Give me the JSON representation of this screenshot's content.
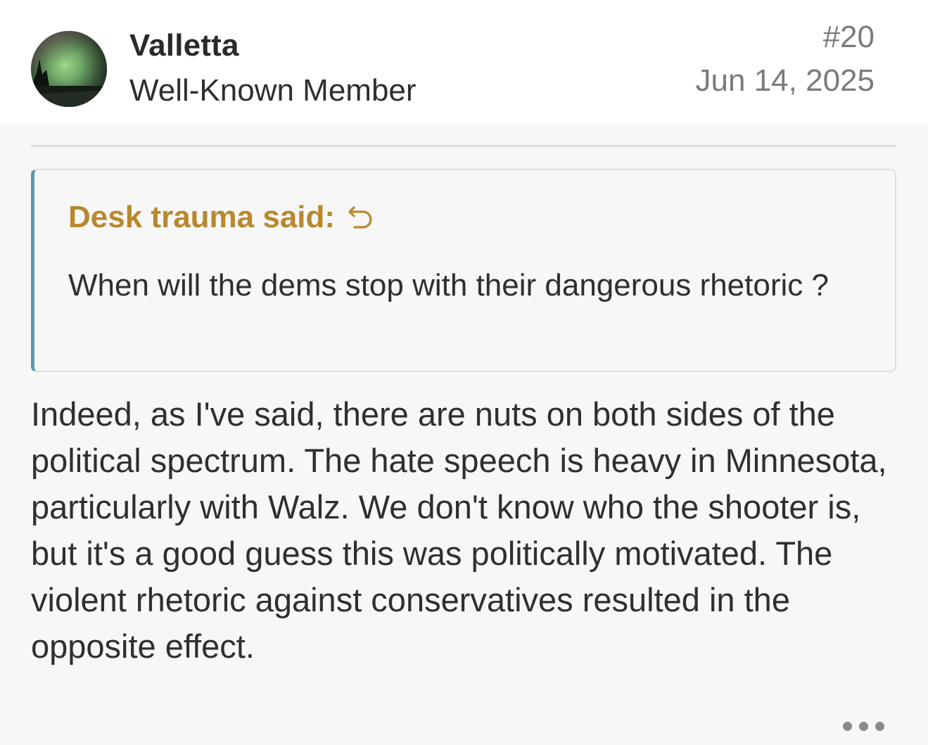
{
  "post": {
    "author": {
      "name": "Valletta",
      "title": "Well-Known Member",
      "avatar_icon": "aurora-landscape-avatar"
    },
    "number": "#20",
    "date": "Jun 14, 2025",
    "quote": {
      "author_label": "Desk trauma said:",
      "jump_icon": "reply-arrow-icon",
      "text": "When will the dems stop with their dangerous rhetoric ?"
    },
    "body": "Indeed, as I've said, there are nuts on both sides of the political spectrum. The hate speech is heavy in Minnesota, particularly with Walz. We don't know who the shooter is, but it's a good guess this was politically motivated. The violent rhetoric against conservatives resulted in the opposite effect.",
    "more_icon": "ellipsis-icon"
  },
  "colors": {
    "quote_author": "#b8882e",
    "quote_border_accent": "#5e98ad",
    "meta_gray": "#7b7b7b",
    "text": "#2f2f2f",
    "header_bg": "#ffffff",
    "body_bg": "#f7f7f7"
  }
}
